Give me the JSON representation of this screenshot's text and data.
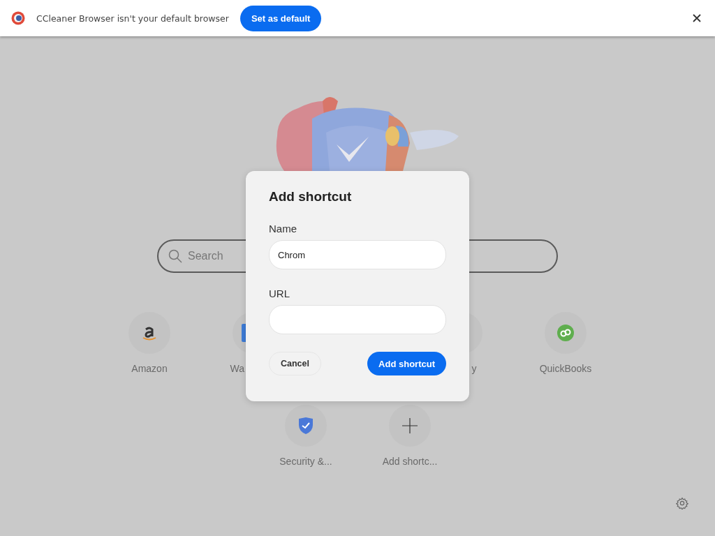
{
  "infobar": {
    "message": "CCleaner Browser isn't your default browser",
    "button": "Set as default"
  },
  "search": {
    "placeholder": "Search"
  },
  "shortcuts": [
    {
      "label": "Amazon",
      "kind": "amazon"
    },
    {
      "label": "Wa",
      "kind": "site"
    },
    {
      "label": "y",
      "kind": "blank"
    },
    {
      "label": "QuickBooks",
      "kind": "quickbooks"
    },
    {
      "label": "Security &...",
      "kind": "shield"
    },
    {
      "label": "Add shortc...",
      "kind": "add"
    }
  ],
  "dialog": {
    "title": "Add shortcut",
    "name_label": "Name",
    "name_value": "Chrom",
    "url_label": "URL",
    "cancel": "Cancel",
    "confirm": "Add shortcut"
  }
}
